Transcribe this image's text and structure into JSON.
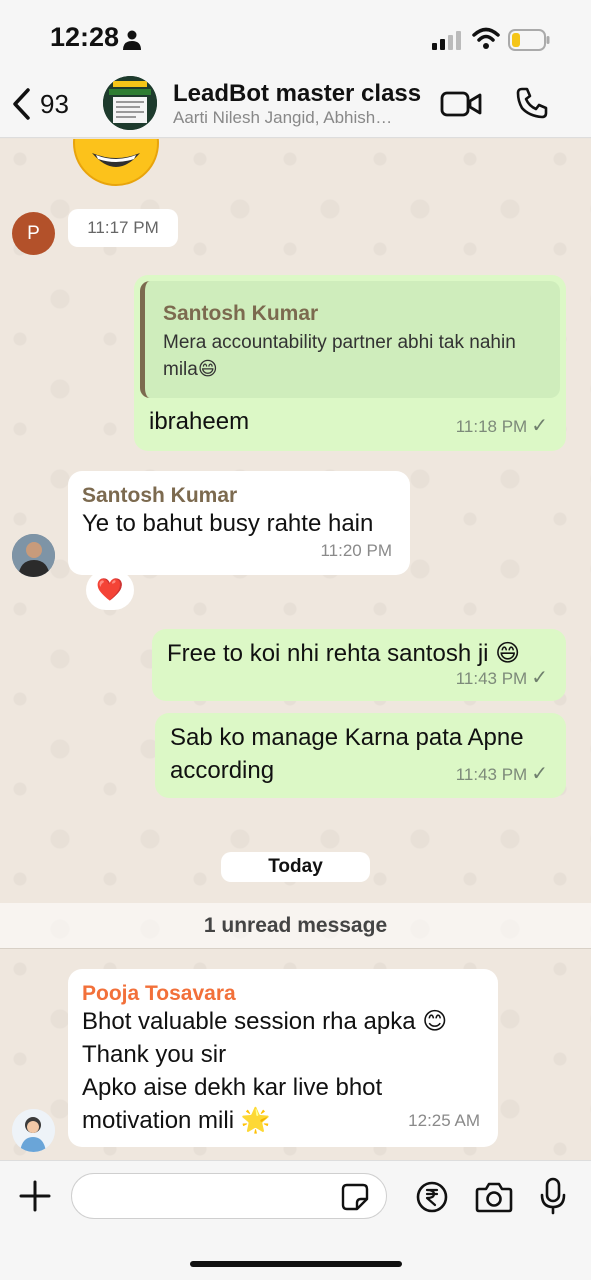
{
  "status_bar": {
    "time": "12:28"
  },
  "header": {
    "back_count": "93",
    "title": "LeadBot master class",
    "members": "Aarti Nilesh Jangid, Abhish…"
  },
  "messages": {
    "first_time": "11:17 PM",
    "first_sender_initial": "P",
    "m1": {
      "quote_name": "Santosh Kumar",
      "quote_text": "Mera accountability partner abhi tak nahin mila😄",
      "text": "ibraheem",
      "time": "11:18 PM"
    },
    "m2": {
      "sender": "Santosh Kumar",
      "text": "Ye to bahut busy rahte hain",
      "time": "11:20 PM",
      "reaction": "❤️"
    },
    "m3": {
      "text": "Free to koi nhi rehta santosh ji 😄",
      "time": "11:43 PM"
    },
    "m4": {
      "text": "Sab ko manage Karna pata Apne according",
      "time": "11:43 PM"
    },
    "date_divider": "Today",
    "unread_banner": "1 unread message",
    "m5": {
      "sender": "Pooja Tosavara",
      "lines": [
        "Bhot valuable session rha apka 😊",
        "Thank you sir",
        "Apko aise dekh kar live bhot",
        "motivation mili 🌟"
      ],
      "time": "12:25 AM"
    }
  },
  "input": {
    "placeholder": ""
  },
  "colors": {
    "outgoing_bubble": "#dcf8c6",
    "incoming_bubble": "#ffffff",
    "quote_accent": "#7c6a4f",
    "santosh_name": "#7c6a4f",
    "pooja_name": "#f2703a"
  }
}
